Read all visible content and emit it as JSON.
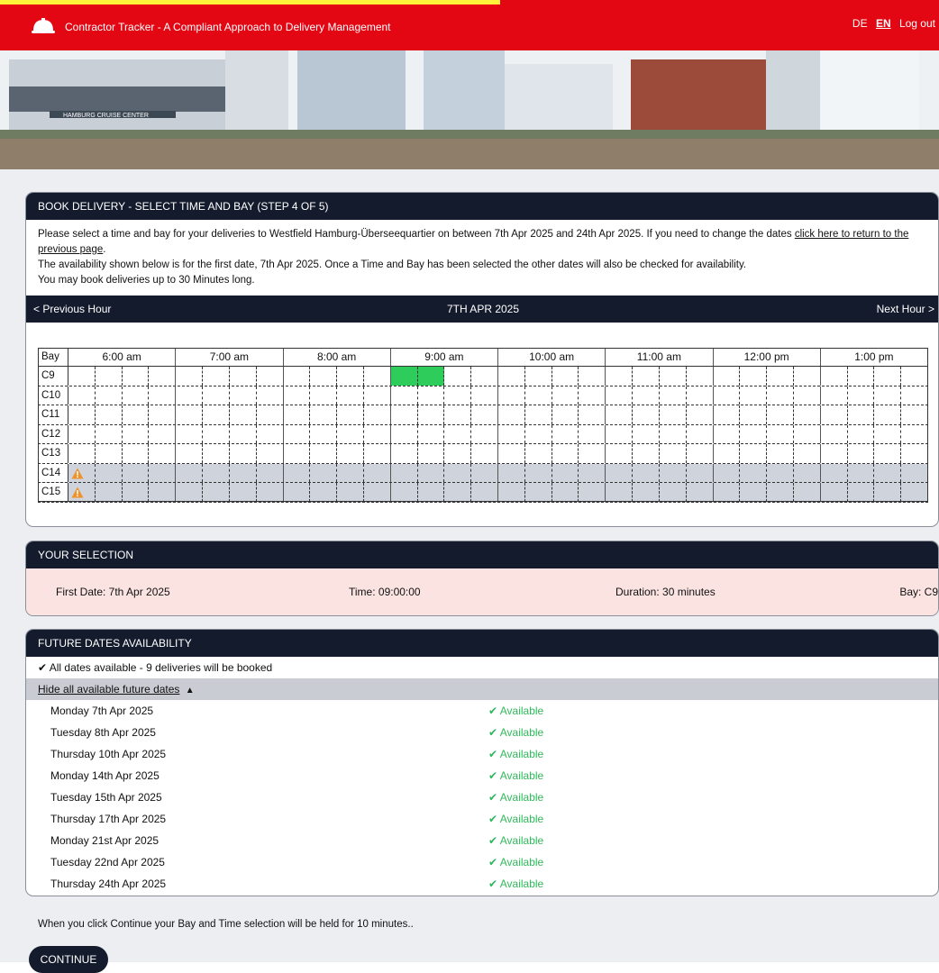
{
  "header": {
    "title": "Contractor Tracker - A Compliant Approach to Delivery Management",
    "lang_de": "DE",
    "lang_en": "EN",
    "logout": "Log out",
    "brand_color": "#e30613"
  },
  "banner": {
    "sign_text": "HAMBURG CRUISE CENTER"
  },
  "booking": {
    "heading": "BOOK DELIVERY - SELECT TIME AND BAY (STEP 4 OF 5)",
    "intro_1": "Please select a time and bay for your deliveries to Westfield Hamburg-Überseequartier on between 7th Apr 2025 and 24th Apr 2025. If you need to change the dates ",
    "intro_link": "click here to return to the previous page",
    "intro_2": "The availability shown below is for the first date, 7th Apr 2025. Once a Time and Bay has been selected the other dates will also be checked for availability.",
    "intro_3": "You may book deliveries up to 30 Minutes long.",
    "prev_hour": "<  Previous Hour",
    "date_label": "7TH APR 2025",
    "next_hour": "Next Hour  >",
    "bay_header": "Bay",
    "hours": [
      "6:00 am",
      "7:00 am",
      "8:00 am",
      "9:00 am",
      "10:00 am",
      "11:00 am",
      "12:00 pm",
      "1:00 pm"
    ],
    "bays": [
      {
        "name": "C9",
        "blocked": false,
        "warning": false
      },
      {
        "name": "C10",
        "blocked": false,
        "warning": false
      },
      {
        "name": "C11",
        "blocked": false,
        "warning": false
      },
      {
        "name": "C12",
        "blocked": false,
        "warning": false
      },
      {
        "name": "C13",
        "blocked": false,
        "warning": false
      },
      {
        "name": "C14",
        "blocked": true,
        "warning": true
      },
      {
        "name": "C15",
        "blocked": true,
        "warning": true
      }
    ],
    "selected_bay": "C9",
    "selected_slot": {
      "hour": "9:00 am",
      "quarters": [
        0,
        1
      ]
    },
    "selected_color": "#2ecc5a",
    "warning_color": "#f0922b"
  },
  "selection": {
    "heading": "YOUR SELECTION",
    "first_date": "First Date: 7th Apr 2025",
    "time": "Time: 09:00:00",
    "duration": "Duration: 30 minutes",
    "bay": "Bay: C9"
  },
  "future": {
    "heading": "FUTURE DATES AVAILABILITY",
    "summary": "All dates available - 9 deliveries will be booked",
    "summary_icon": "check-icon",
    "hide_link": "Hide all available future dates",
    "dates": [
      {
        "date": "Monday 7th Apr 2025",
        "status": "Available"
      },
      {
        "date": "Tuesday 8th Apr 2025",
        "status": "Available"
      },
      {
        "date": "Thursday 10th Apr 2025",
        "status": "Available"
      },
      {
        "date": "Monday 14th Apr 2025",
        "status": "Available"
      },
      {
        "date": "Tuesday 15th Apr 2025",
        "status": "Available"
      },
      {
        "date": "Thursday 17th Apr 2025",
        "status": "Available"
      },
      {
        "date": "Monday 21st Apr 2025",
        "status": "Available"
      },
      {
        "date": "Tuesday 22nd Apr 2025",
        "status": "Available"
      },
      {
        "date": "Thursday 24th Apr 2025",
        "status": "Available"
      }
    ]
  },
  "footer": {
    "note": "When you click Continue your Bay and Time selection will be held for 10 minutes..",
    "continue_label": "CONTINUE"
  }
}
